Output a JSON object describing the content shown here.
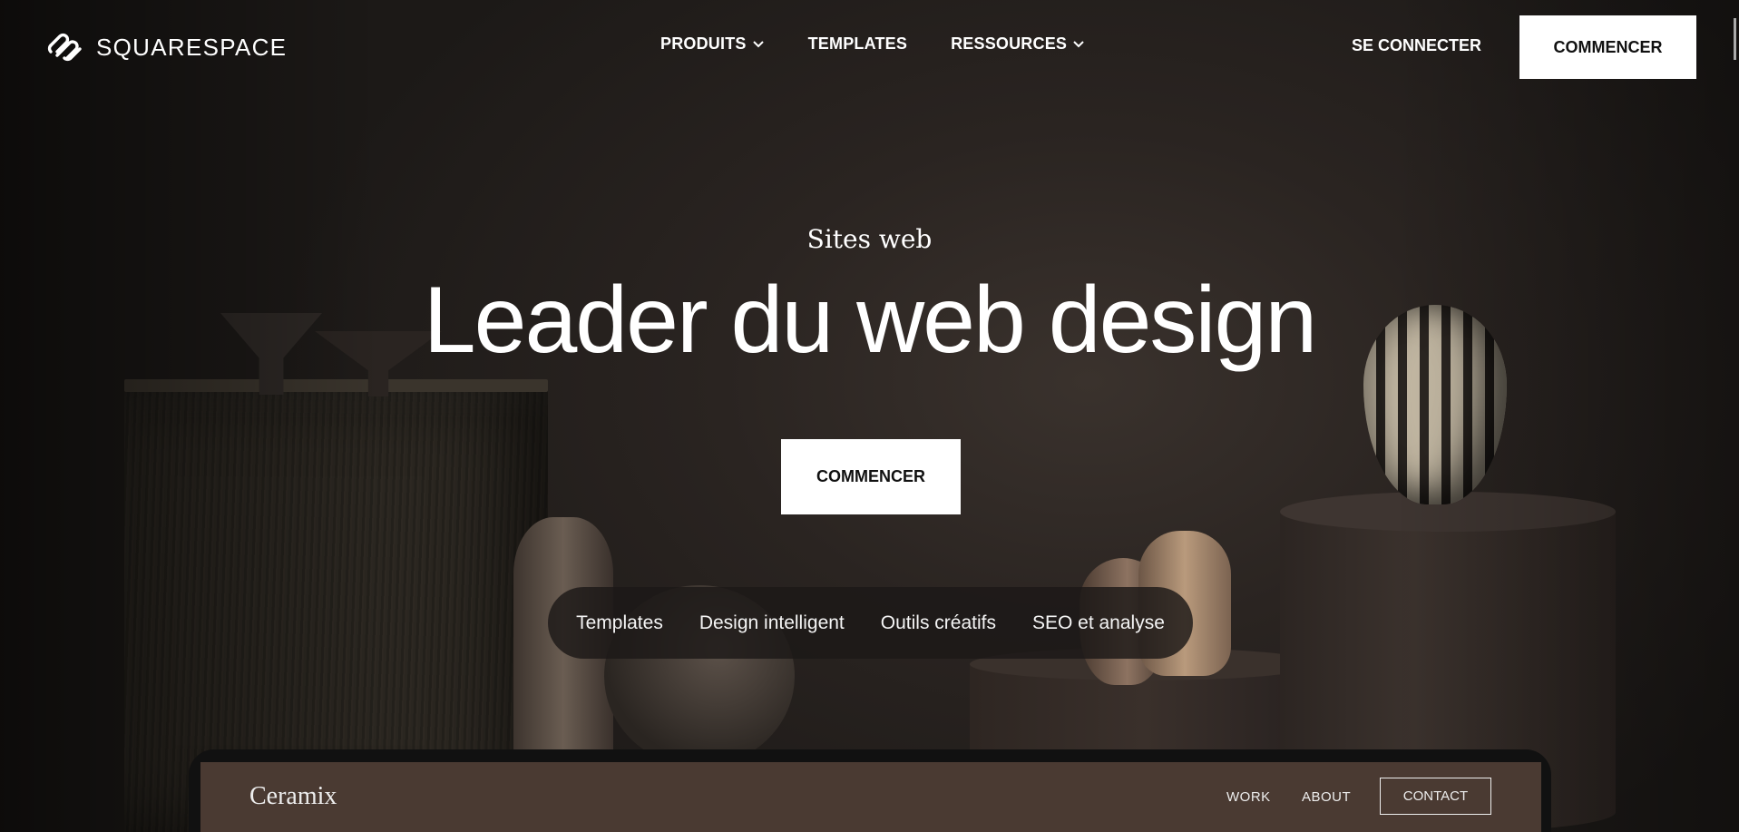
{
  "brand": {
    "name": "SQUARESPACE",
    "icon": "squarespace-logo-icon"
  },
  "nav": {
    "items": [
      {
        "label": "PRODUITS",
        "has_dropdown": true
      },
      {
        "label": "TEMPLATES",
        "has_dropdown": false
      },
      {
        "label": "RESSOURCES",
        "has_dropdown": true
      }
    ],
    "login": "SE CONNECTER",
    "cta": "COMMENCER"
  },
  "hero": {
    "eyebrow": "Sites web",
    "headline": "Leader du web design",
    "cta": "COMMENCER"
  },
  "feature_tabs": [
    "Templates",
    "Design intelligent",
    "Outils créatifs",
    "SEO et analyse"
  ],
  "preview": {
    "site_name": "Ceramix",
    "links": [
      "WORK",
      "ABOUT"
    ],
    "contact": "CONTACT"
  },
  "colors": {
    "background": "#1d1a18",
    "button_bg": "#ffffff",
    "button_text": "#111111",
    "preview_bar": "#4a3a32"
  }
}
